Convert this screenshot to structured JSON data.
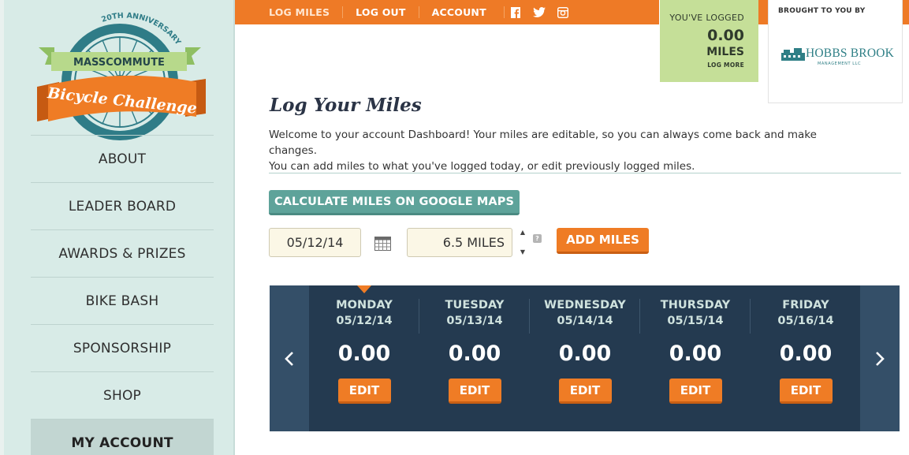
{
  "logo": {
    "anniversary": "20TH ANNIVERSARY",
    "org": "MASSCOMMUTE",
    "event": "Bicycle Challenge"
  },
  "sidebar": {
    "items": [
      {
        "label": "ABOUT"
      },
      {
        "label": "LEADER BOARD"
      },
      {
        "label": "AWARDS & PRIZES"
      },
      {
        "label": "BIKE BASH"
      },
      {
        "label": "SPONSORSHIP"
      },
      {
        "label": "SHOP"
      },
      {
        "label": "MY ACCOUNT",
        "active": true
      }
    ]
  },
  "topbar": {
    "links": [
      "LOG MILES",
      "LOG OUT",
      "ACCOUNT"
    ],
    "social": [
      "facebook-icon",
      "twitter-icon",
      "instagram-icon"
    ],
    "color": "#ee7a26"
  },
  "logged": {
    "label": "YOU'VE LOGGED",
    "value": "0.00",
    "unit": "MILES",
    "more": "LOG MORE"
  },
  "sponsor": {
    "label": "BROUGHT TO YOU BY",
    "name": "HOBBS BROOK",
    "sub": "MANAGEMENT LLC"
  },
  "main": {
    "title": "Log Your Miles",
    "intro_line1": "Welcome to your account Dashboard! Your miles are editable, so you can always come back and make changes.",
    "intro_line2": "You can add miles to what you've logged today, or edit previously logged miles.",
    "maps_button": "CALCULATE MILES ON GOOGLE MAPS",
    "date_value": "05/12/14",
    "miles_value": "6.5 MILES",
    "help": "?",
    "add_button": "ADD MILES"
  },
  "week": {
    "days": [
      {
        "name": "MONDAY",
        "date": "05/12/14",
        "value": "0.00",
        "edit": "EDIT"
      },
      {
        "name": "TUESDAY",
        "date": "05/13/14",
        "value": "0.00",
        "edit": "EDIT"
      },
      {
        "name": "WEDNESDAY",
        "date": "05/14/14",
        "value": "0.00",
        "edit": "EDIT"
      },
      {
        "name": "THURSDAY",
        "date": "05/15/14",
        "value": "0.00",
        "edit": "EDIT"
      },
      {
        "name": "FRIDAY",
        "date": "05/16/14",
        "value": "0.00",
        "edit": "EDIT"
      }
    ],
    "prev_icon": "chevron-left-icon",
    "next_icon": "chevron-right-icon"
  },
  "colors": {
    "accent": "#ef7c25",
    "teal": "#5ea39a",
    "navy": "#243a50",
    "sidebar": "#d8ebe7",
    "logged_bg": "#c5df98"
  }
}
